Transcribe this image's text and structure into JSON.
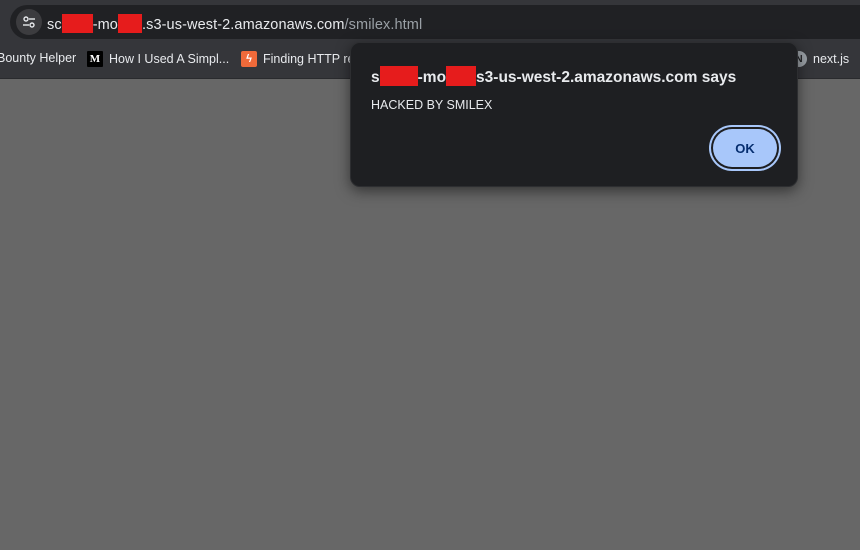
{
  "address_bar": {
    "url_seg1": "sc",
    "url_seg2": "-mo",
    "url_seg3": ".s3-us-west-2.amazonaws.com",
    "url_path": "/smilex.html"
  },
  "bookmarks": [
    {
      "label": "Bounty Helper",
      "icon": "none"
    },
    {
      "label": "How I Used A Simpl...",
      "icon": "medium-icon"
    },
    {
      "label": "Finding HTTP re",
      "icon": "spark-icon"
    },
    {
      "label": "next.js",
      "icon": "next-icon"
    }
  ],
  "dialog": {
    "title_seg1": "s",
    "title_seg2": "-mo",
    "title_seg3": "s3-us-west-2.amazonaws.com says",
    "message": "HACKED BY SMILEX",
    "ok_label": "OK"
  },
  "colors": {
    "page_background": "#676767",
    "chrome": "#35363a",
    "dialog_background": "#1e1f22",
    "ok_button": "#a8c7fa",
    "redaction": "#e61c1c"
  }
}
